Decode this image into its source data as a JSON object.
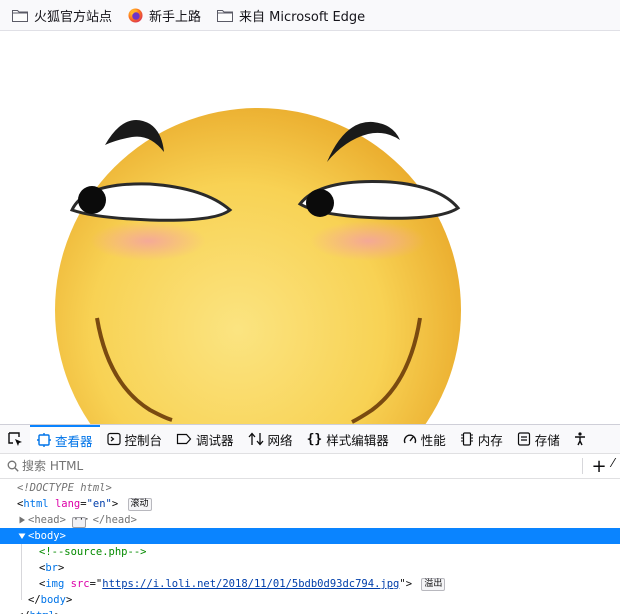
{
  "bookmarks": [
    {
      "label": "火狐官方站点",
      "icon": "folder-icon"
    },
    {
      "label": "新手上路",
      "icon": "firefox-icon"
    },
    {
      "label": "来自 Microsoft Edge",
      "icon": "folder-icon"
    }
  ],
  "devtools": {
    "tabs": [
      {
        "label": "查看器",
        "icon": "inspector-icon",
        "selected": true
      },
      {
        "label": "控制台",
        "icon": "console-icon"
      },
      {
        "label": "调试器",
        "icon": "debugger-icon"
      },
      {
        "label": "网络",
        "icon": "network-icon"
      },
      {
        "label": "样式编辑器",
        "icon": "style-editor-icon"
      },
      {
        "label": "性能",
        "icon": "performance-icon"
      },
      {
        "label": "内存",
        "icon": "memory-icon"
      },
      {
        "label": "存储",
        "icon": "storage-icon"
      }
    ],
    "search_placeholder": "搜索 HTML",
    "markup": {
      "doctype": "<!DOCTYPE html>",
      "html_open_tag": "html",
      "html_attr_name": "lang",
      "html_attr_value": "\"en\"",
      "scroll_badge": "滚动",
      "head_tag": "head",
      "body_tag": "body",
      "comment": "<!--source.php-->",
      "br_tag": "br",
      "img_tag": "img",
      "img_attr_name": "src",
      "img_src": "https://i.loli.net/2018/11/01/5bdb0d93dc794.jpg",
      "overflow_badge": "溢出",
      "body_close": "body",
      "html_close": "html"
    }
  }
}
